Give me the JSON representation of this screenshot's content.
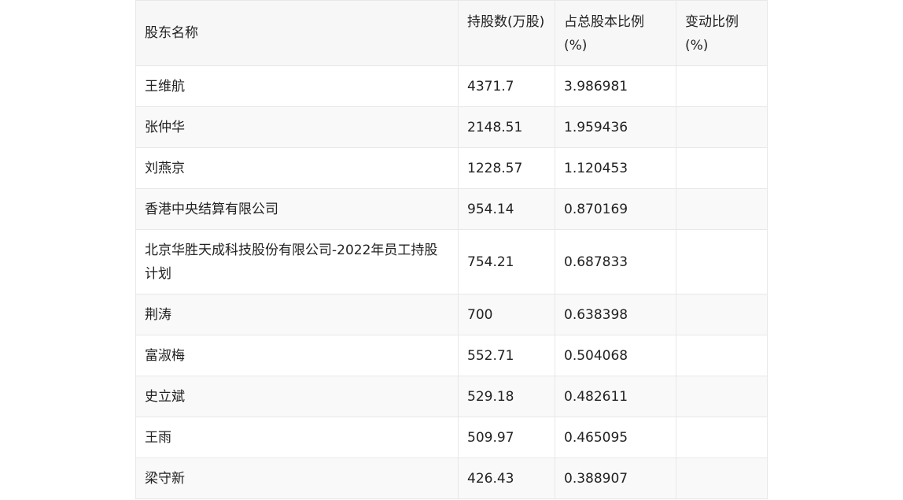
{
  "table": {
    "headers": [
      "股东名称",
      "持股数(万股)",
      "占总股本比例(%)",
      "变动比例(%)"
    ],
    "rows": [
      [
        "王维航",
        "4371.7",
        "3.986981",
        ""
      ],
      [
        "张仲华",
        "2148.51",
        "1.959436",
        ""
      ],
      [
        "刘燕京",
        "1228.57",
        "1.120453",
        ""
      ],
      [
        "香港中央结算有限公司",
        "954.14",
        "0.870169",
        ""
      ],
      [
        "北京华胜天成科技股份有限公司-2022年员工持股计划",
        "754.21",
        "0.687833",
        ""
      ],
      [
        "荆涛",
        "700",
        "0.638398",
        ""
      ],
      [
        "富淑梅",
        "552.71",
        "0.504068",
        ""
      ],
      [
        "史立斌",
        "529.18",
        "0.482611",
        ""
      ],
      [
        "王雨",
        "509.97",
        "0.465095",
        ""
      ],
      [
        "梁守新",
        "426.43",
        "0.388907",
        ""
      ]
    ]
  }
}
